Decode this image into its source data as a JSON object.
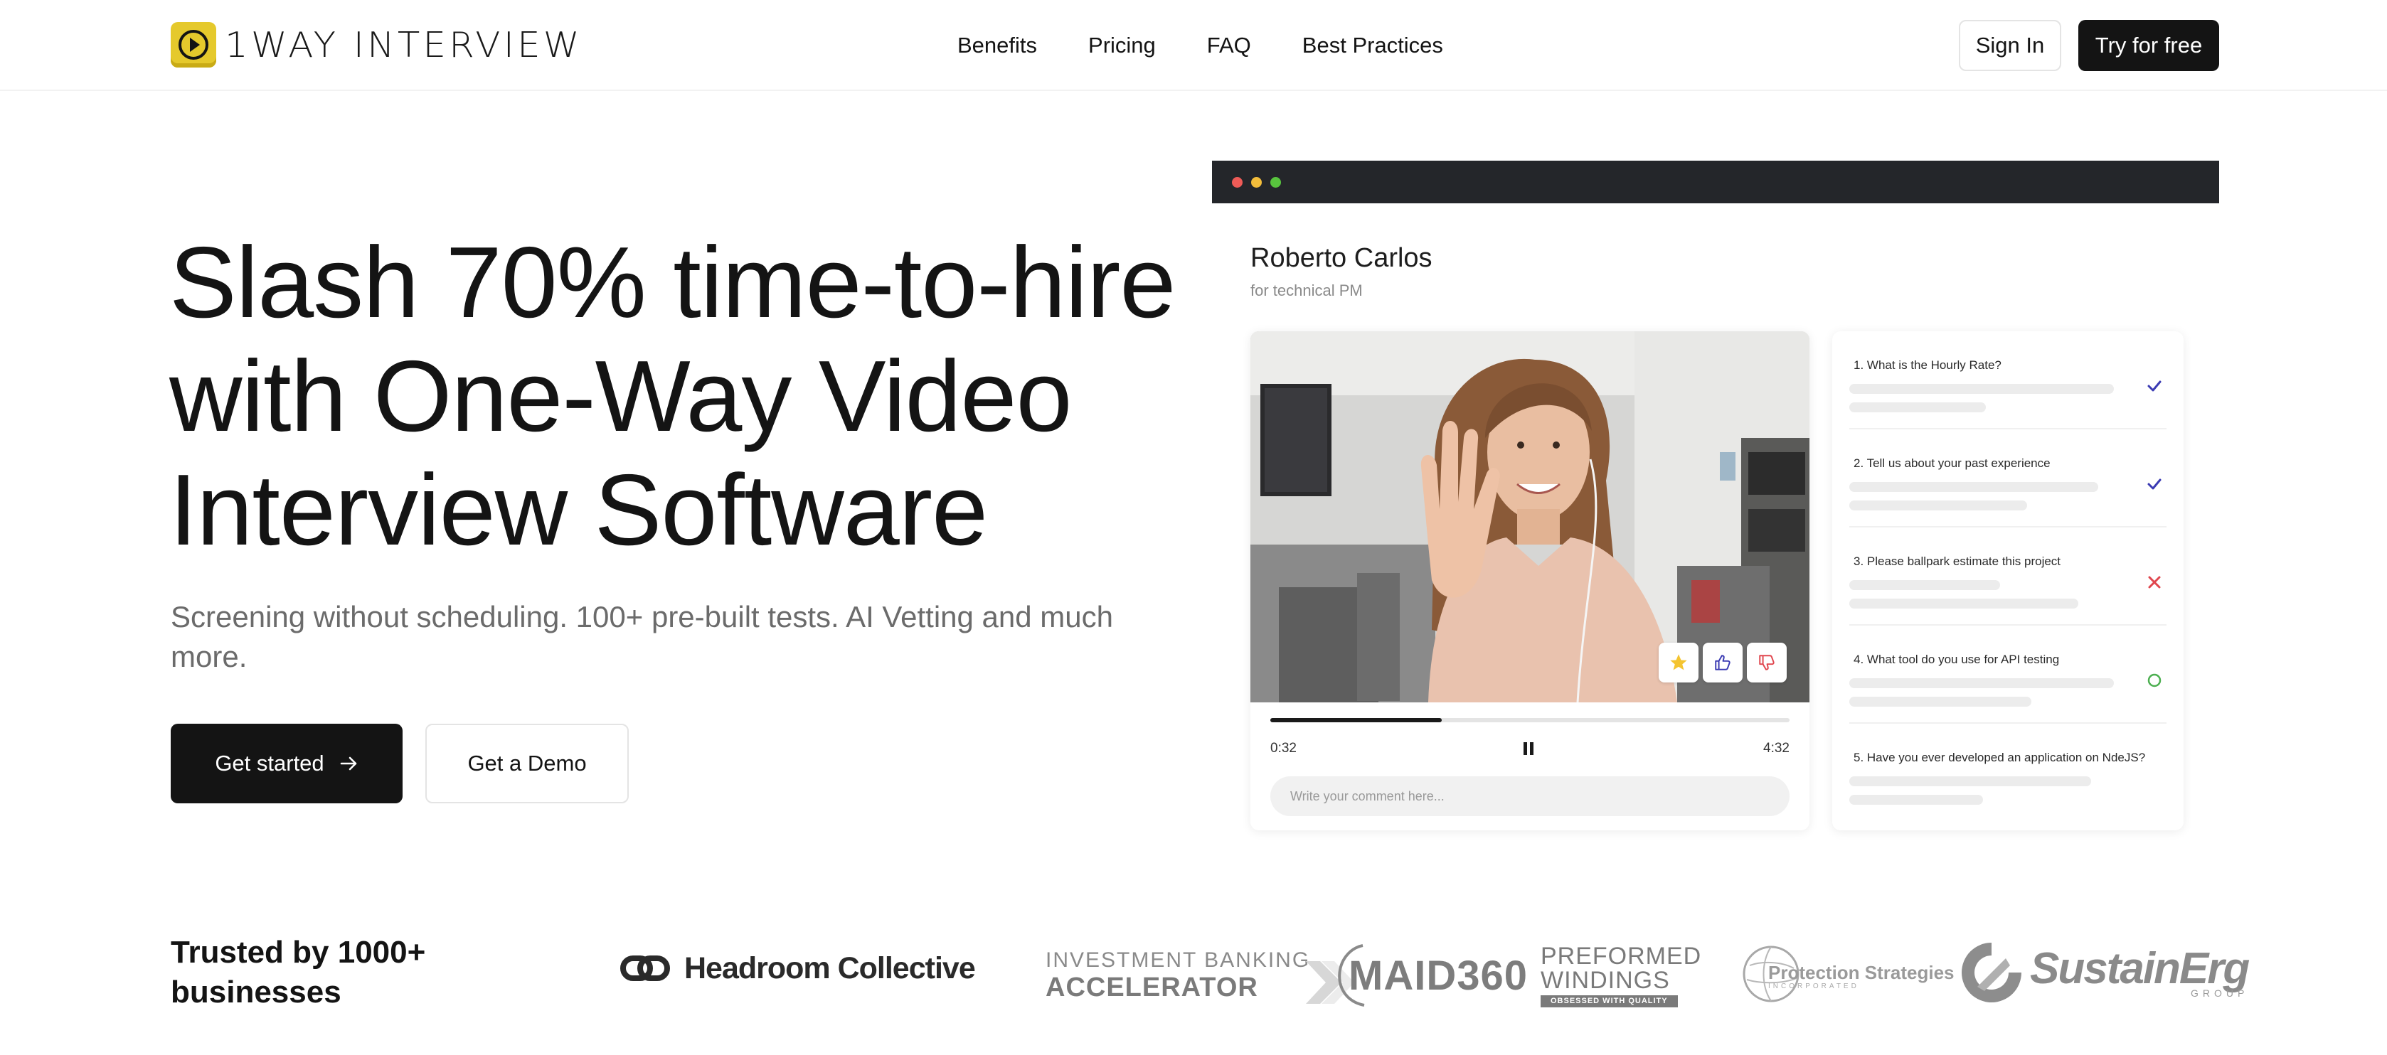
{
  "header": {
    "logo_text": "1WAY INTERVIEW",
    "nav": [
      "Benefits",
      "Pricing",
      "FAQ",
      "Best Practices"
    ],
    "sign_in": "Sign In",
    "try_free": "Try for free"
  },
  "hero": {
    "title_lines": [
      "Slash 70% time-to-hire",
      "with One-Way Video",
      "Interview Software"
    ],
    "subtitle": "Screening without scheduling. 100+ pre-built tests. AI Vetting and much more.",
    "get_started": "Get started",
    "get_demo": "Get a Demo"
  },
  "mock": {
    "candidate_name": "Roberto Carlos",
    "candidate_role": "for technical PM",
    "playback_progress": 0.33,
    "time_current": "0:32",
    "time_total": "4:32",
    "comment_placeholder": "Write your comment here...",
    "reactions": [
      "star-icon",
      "thumbs-up-icon",
      "thumbs-down-icon"
    ],
    "questions": [
      {
        "text": "1. What is the Hourly Rate?",
        "status": "check"
      },
      {
        "text": "2. Tell us about your past experience",
        "status": "check"
      },
      {
        "text": "3. Please ballpark estimate this project",
        "status": "cross"
      },
      {
        "text": "4. What tool do you use for API testing",
        "status": "pending"
      },
      {
        "text": "5. Have you ever developed an application on NdeJS?",
        "status": "none"
      }
    ]
  },
  "trusted": {
    "text": "Trusted by 1000+ businesses",
    "logos": {
      "headroom": "Headroom Collective",
      "iba_line1": "INVESTMENT BANKING",
      "iba_line2": "ACCELERATOR",
      "maid": "MAID360",
      "pw_line1": "PREFORMED",
      "pw_line2": "WINDINGS",
      "pw_tag": "OBSESSED WITH QUALITY",
      "ps_line1": "Protection Strategies",
      "ps_line2": "INCORPORATED",
      "se_line1": "SustainErg",
      "se_line2": "GROUP"
    }
  },
  "colors": {
    "brand_yellow": "#e5c92c",
    "dark": "#141414",
    "check_blue": "#3b3bb3",
    "cross_red": "#e0464e",
    "pending_green": "#4caf50"
  }
}
